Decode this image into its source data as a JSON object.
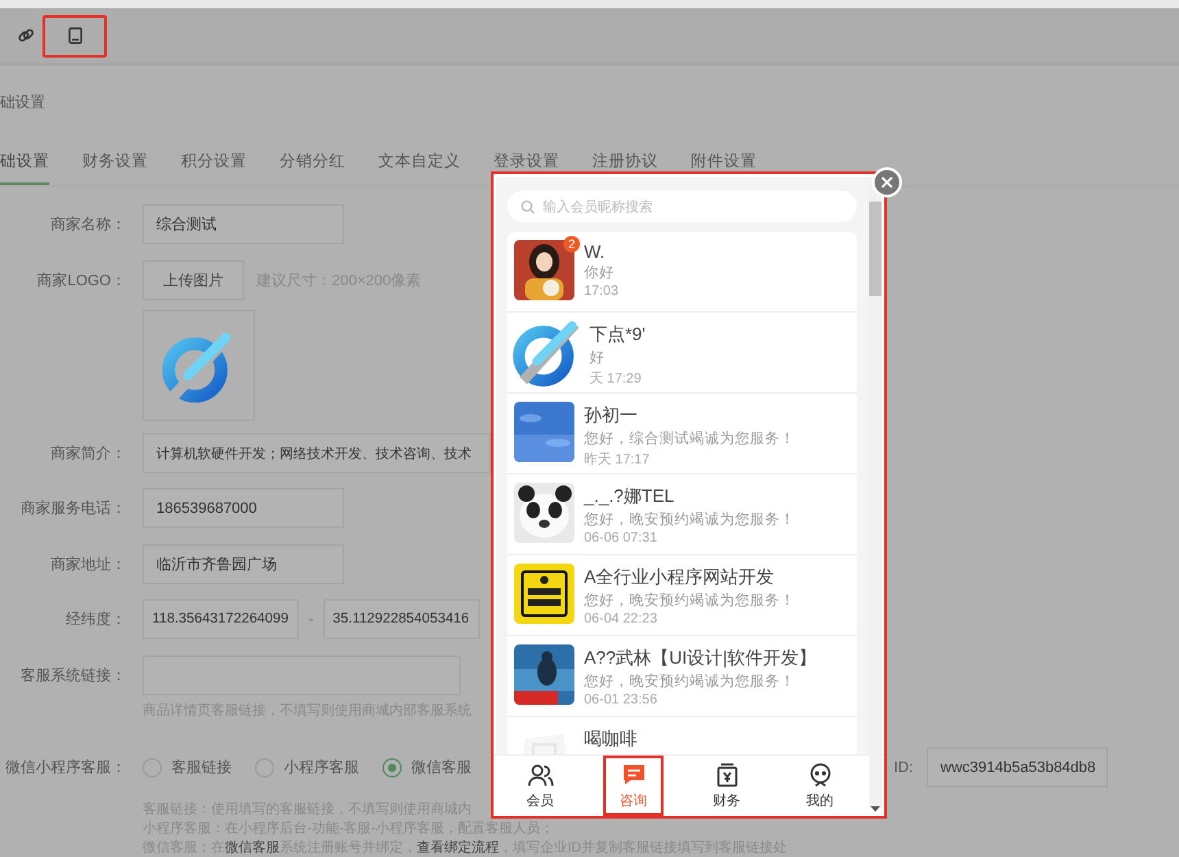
{
  "toolbar": {
    "icons": [
      {
        "kind": "link",
        "highlighted": false
      },
      {
        "kind": "tablet",
        "highlighted": true
      }
    ]
  },
  "page_title": "础设置",
  "tabs": [
    {
      "label": "础设置",
      "selected": true
    },
    {
      "label": "财务设置",
      "selected": false
    },
    {
      "label": "积分设置",
      "selected": false
    },
    {
      "label": "分销分红",
      "selected": false
    },
    {
      "label": "文本自定义",
      "selected": false
    },
    {
      "label": "登录设置",
      "selected": false
    },
    {
      "label": "注册协议",
      "selected": false
    },
    {
      "label": "附件设置",
      "selected": false
    }
  ],
  "form": {
    "merchant_name": {
      "label": "商家名称：",
      "value": "综合测试"
    },
    "logo": {
      "label": "商家LOGO：",
      "button": "上传图片",
      "hint": "建议尺寸：200×200像素"
    },
    "intro": {
      "label": "商家简介：",
      "value": "计算机软硬件开发；网络技术开发、技术咨询、技术"
    },
    "phone": {
      "label": "商家服务电话：",
      "value": "186539687000"
    },
    "address": {
      "label": "商家地址：",
      "value": "临沂市齐鲁园广场"
    },
    "coordinates": {
      "label": "经纬度：",
      "longitude": "118.35643172264099",
      "separator": "-",
      "latitude": "35.112922854053416"
    },
    "service_link": {
      "label": "客服系统链接：",
      "hint": "商品详情页客服链接，不填写则使用商城内部客服系统"
    },
    "wechat_service": {
      "label": "微信小程序客服：",
      "options": [
        {
          "label": "客服链接",
          "selected": false
        },
        {
          "label": "小程序客服",
          "selected": false
        },
        {
          "label": "微信客服",
          "selected": true
        }
      ],
      "id_label": "ID:",
      "id_value": "wwc3914b5a53b84db8",
      "help": [
        {
          "text": "客服链接：使用填写的客服链接，不填写则使用商城内"
        },
        {
          "text": "小程序客服：在小程序后台-功能-客服-小程序客服，配置客服人员；"
        },
        {
          "text": "微信客服：在**微信客服**系统注册账号并绑定，",
          "link": "查看绑定流程",
          "after": "，填写企业ID并复制客服链接填写到客服链接处"
        }
      ]
    }
  },
  "chat_panel": {
    "search_placeholder": "输入会员昵称搜索",
    "items": [
      {
        "kind": "picture",
        "badge": "2",
        "name": "W.",
        "preview": "你好",
        "time": "17:03"
      },
      {
        "kind": "logo",
        "name": "下点*9'",
        "preview": "好",
        "time": "天 17:29"
      },
      {
        "kind": "picture",
        "name": "孙初一",
        "preview": "您好，综合测试竭诚为您服务！",
        "time": "昨天 17:17"
      },
      {
        "kind": "picture",
        "name": "_._.?娜TEL",
        "preview": "您好，晚安预约竭诚为您服务！",
        "time": "06-06 07:31"
      },
      {
        "kind": "picture",
        "name": "A全行业小程序网站开发",
        "preview": "您好，晚安预约竭诚为您服务！",
        "time": "06-04 22:23"
      },
      {
        "kind": "picture",
        "name": "A??武林【UI设计|软件开发】",
        "preview": "您好，晚安预约竭诚为您服务！",
        "time": "06-01 23:56"
      },
      {
        "kind": "picture",
        "name": "喝咖啡"
      }
    ],
    "tabs": [
      {
        "kind": "members",
        "label": "会员",
        "selected": false,
        "highlighted": false
      },
      {
        "kind": "chat",
        "label": "咨询",
        "selected": true,
        "highlighted": true
      },
      {
        "kind": "finance",
        "label": "财务",
        "selected": false,
        "highlighted": false
      },
      {
        "kind": "profile",
        "label": "我的",
        "selected": false,
        "highlighted": false
      }
    ]
  }
}
